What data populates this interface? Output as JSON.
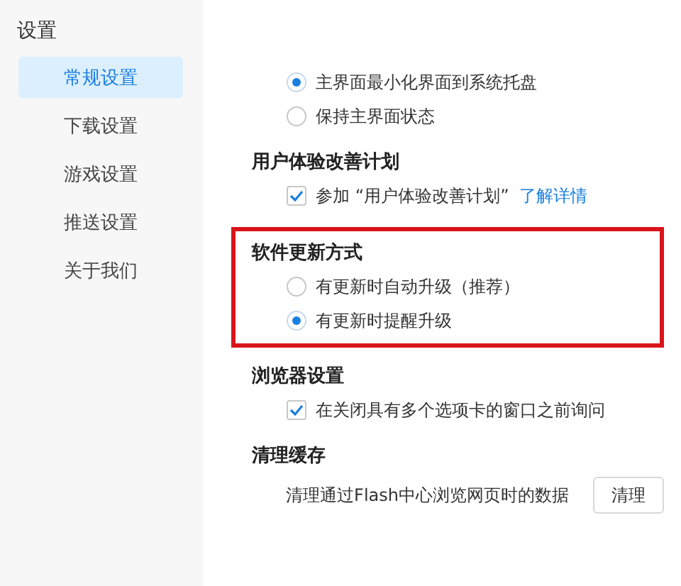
{
  "sidebar": {
    "title": "设置",
    "items": [
      {
        "label": "常规设置",
        "selected": true
      },
      {
        "label": "下载设置",
        "selected": false
      },
      {
        "label": "游戏设置",
        "selected": false
      },
      {
        "label": "推送设置",
        "selected": false
      },
      {
        "label": "关于我们",
        "selected": false
      }
    ]
  },
  "sections": [
    {
      "highlighted": false,
      "options": [
        {
          "kind": "radio",
          "label": "主界面最小化界面到系统托盘",
          "selected": true
        },
        {
          "kind": "radio",
          "label": "保持主界面状态",
          "selected": false
        }
      ]
    },
    {
      "title": "用户体验改善计划",
      "highlighted": false,
      "options": [
        {
          "kind": "checkbox",
          "label": "参加 “用户体验改善计划”",
          "checked": true,
          "link": "了解详情"
        }
      ]
    },
    {
      "title": "软件更新方式",
      "highlighted": true,
      "options": [
        {
          "kind": "radio",
          "label": "有更新时自动升级（推荐）",
          "selected": false
        },
        {
          "kind": "radio",
          "label": "有更新时提醒升级",
          "selected": true
        }
      ]
    },
    {
      "title": "浏览器设置",
      "highlighted": false,
      "options": [
        {
          "kind": "checkbox",
          "label": "在关闭具有多个选项卡的窗口之前询问",
          "checked": true
        }
      ]
    },
    {
      "title": "清理缓存",
      "highlighted": false,
      "options": [
        {
          "kind": "action",
          "label": "清理通过Flash中心浏览网页时的数据",
          "button": "清理"
        }
      ]
    }
  ]
}
